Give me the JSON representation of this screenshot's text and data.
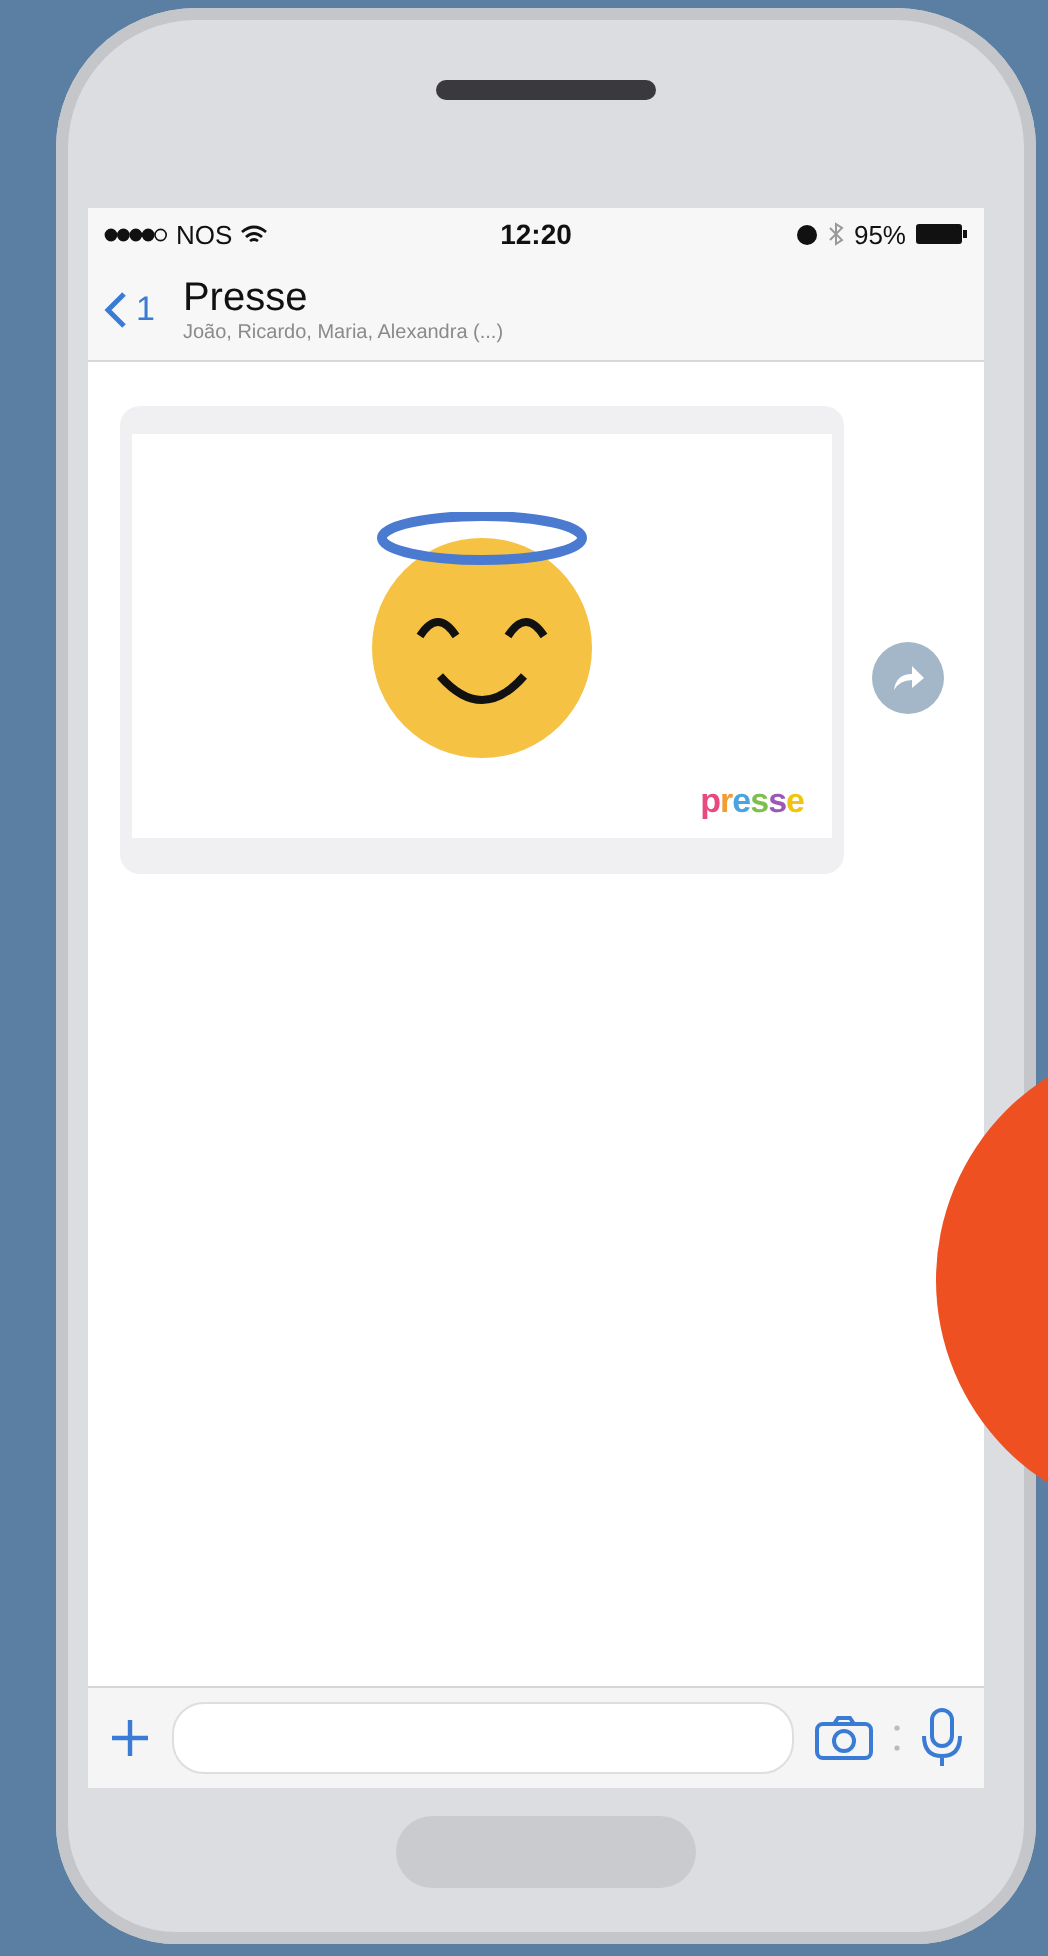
{
  "status_bar": {
    "carrier": "NOS",
    "time": "12:20",
    "battery": "95%"
  },
  "header": {
    "back_count": "1",
    "title": "Presse",
    "subtitle": "João, Ricardo, Maria, Alexandra (...)"
  },
  "message": {
    "logo": "presse"
  }
}
